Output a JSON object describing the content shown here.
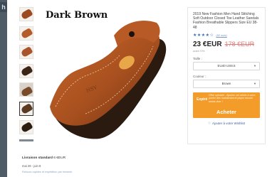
{
  "app": {
    "logo_text": "h"
  },
  "gallery": {
    "caption": "Dark Brown",
    "thumb_colors": [
      "#9c4a20",
      "#b55a28",
      "#a9542a",
      "#3b2516",
      "#d8d2c8",
      "#5b3a22",
      "#2c1d12"
    ]
  },
  "product": {
    "title": "2019 New Fashion Men Hand Stitching Soft Outdoor Closed Toe Leather Sandals Fashion Breathable Slippers Size EU 38-48",
    "rating_stars": "★★★★☆",
    "rating_count": "(82 avis)",
    "price": "23 €EUR",
    "old_price": "178 €EUR",
    "price_note": "avant 70%"
  },
  "options": {
    "size_label": "Taille :",
    "size_value": "EU40 US8.5",
    "color_label": "Couleur :",
    "color_value": "Brown"
  },
  "purchase": {
    "promo_tag": "Expiré",
    "promo_text": "Offre spéciale - Ajoutez cet article à votre panier dès maintenant et payez encore moins cher !",
    "buy_label": "Acheter",
    "wishlist_label": "Ajouter à votre Wishlist"
  },
  "shipping": {
    "method": "Livraison standard",
    "cost": "6 €EUR",
    "delivery": "mai 26 - juin 8",
    "returns": "Retours rapides et expédition par Ireweek"
  },
  "colors": {
    "accent": "#f39c2a",
    "link": "#3a5f9a",
    "strip": "#4f5b66"
  }
}
